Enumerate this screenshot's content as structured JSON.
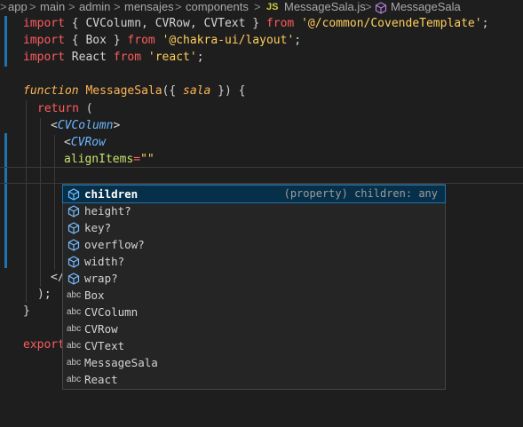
{
  "breadcrumb": {
    "items": [
      "app",
      "main",
      "admin",
      "mensajes",
      "components"
    ],
    "file_badge": "JS",
    "file": "MessageSala.js",
    "symbol": "MessageSala",
    "separator": ">"
  },
  "code": {
    "line1": {
      "kw": "import",
      "a": " { CVColumn, CVRow, CVText } ",
      "from": "from",
      "b": " ",
      "str": "'@/common/CovendeTemplate'",
      "c": ";"
    },
    "line2": {
      "kw": "import",
      "a": " { Box } ",
      "from": "from",
      "b": " ",
      "str": "'@chakra-ui/layout'",
      "c": ";"
    },
    "line3": {
      "kw": "import",
      "a": " React ",
      "from": "from",
      "b": " ",
      "str": "'react'",
      "c": ";"
    },
    "line5": {
      "kw": "function",
      "name": "MessageSala",
      "a": "({ ",
      "param": "sala",
      "b": " }) {"
    },
    "line6": {
      "kw": "return",
      "a": " ("
    },
    "line7": {
      "open": "<",
      "tag": "CVColumn",
      "close": ">"
    },
    "line8": {
      "open": "<",
      "tag": "CVRow"
    },
    "line9": {
      "attr": "alignItems",
      "eq": "=",
      "str": "\"\""
    },
    "line_close_tag": "</",
    "line_paren": ");",
    "line_brace": "}",
    "line_export": "export"
  },
  "suggest": {
    "items": [
      {
        "kind": "property",
        "label": "children",
        "detail": "(property) children: any",
        "selected": true
      },
      {
        "kind": "property",
        "label": "height?"
      },
      {
        "kind": "property",
        "label": "key?"
      },
      {
        "kind": "property",
        "label": "overflow?"
      },
      {
        "kind": "property",
        "label": "width?"
      },
      {
        "kind": "property",
        "label": "wrap?"
      },
      {
        "kind": "text",
        "badge": "abc",
        "label": "Box"
      },
      {
        "kind": "text",
        "badge": "abc",
        "label": "CVColumn"
      },
      {
        "kind": "text",
        "badge": "abc",
        "label": "CVRow"
      },
      {
        "kind": "text",
        "badge": "abc",
        "label": "CVText"
      },
      {
        "kind": "text",
        "badge": "abc",
        "label": "MessageSala"
      },
      {
        "kind": "text",
        "badge": "abc",
        "label": "React"
      }
    ]
  },
  "colors": {
    "accent": "#1f73b0",
    "keyword": "#ff5c5c",
    "string": "#ffce5b",
    "tag": "#6cb6ff",
    "background": "#1e1e1e"
  }
}
